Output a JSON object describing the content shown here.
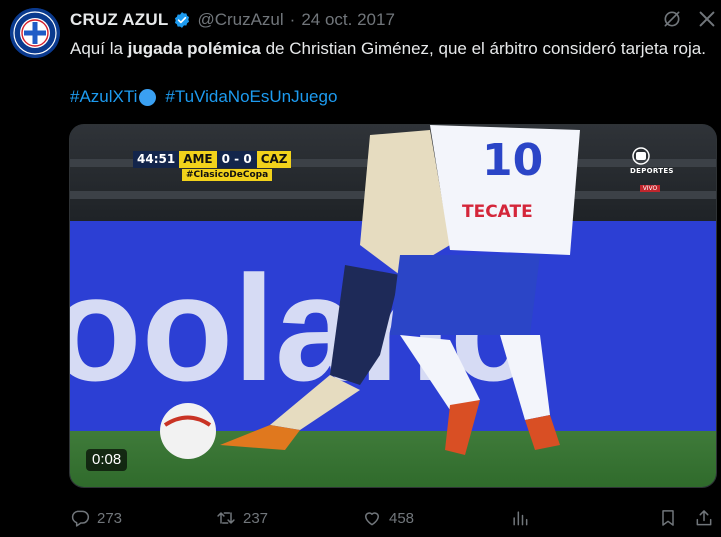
{
  "account": {
    "display_name": "CRUZ AZUL",
    "handle": "@CruzAzul",
    "separator": "·",
    "date": "24 oct. 2017",
    "verified": true
  },
  "tweet": {
    "text_before": "Aquí la ",
    "text_bold": "jugada polémica",
    "text_after": " de Christian Giménez, que el árbitro consideró tarjeta roja.",
    "hashtag_1": "#AzulXTi",
    "hashtag_2": "#TuVidaNoEsUnJuego"
  },
  "media": {
    "clock": "44:51",
    "home_team": "AME",
    "score": "0 - 0",
    "away_team": "CAZ",
    "match_hashtag": "#ClasicoDeCopa",
    "network_name": "DEPORTES",
    "network_sub": "VIVO",
    "jersey_number": "10",
    "sponsor": "TECATE",
    "duration": "0:08"
  },
  "actions": {
    "replies": "273",
    "retweets": "237",
    "likes": "458"
  },
  "colors": {
    "background": "#000000",
    "text": "#e7e9ea",
    "muted": "#71767b",
    "link": "#1d9bf0",
    "verified": "#1d9bf0"
  },
  "icons": [
    "cruz-azul-logo",
    "verified-badge-icon",
    "grok-icon",
    "close-icon",
    "reply-icon",
    "retweet-icon",
    "like-icon",
    "views-icon",
    "bookmark-icon",
    "share-icon"
  ]
}
